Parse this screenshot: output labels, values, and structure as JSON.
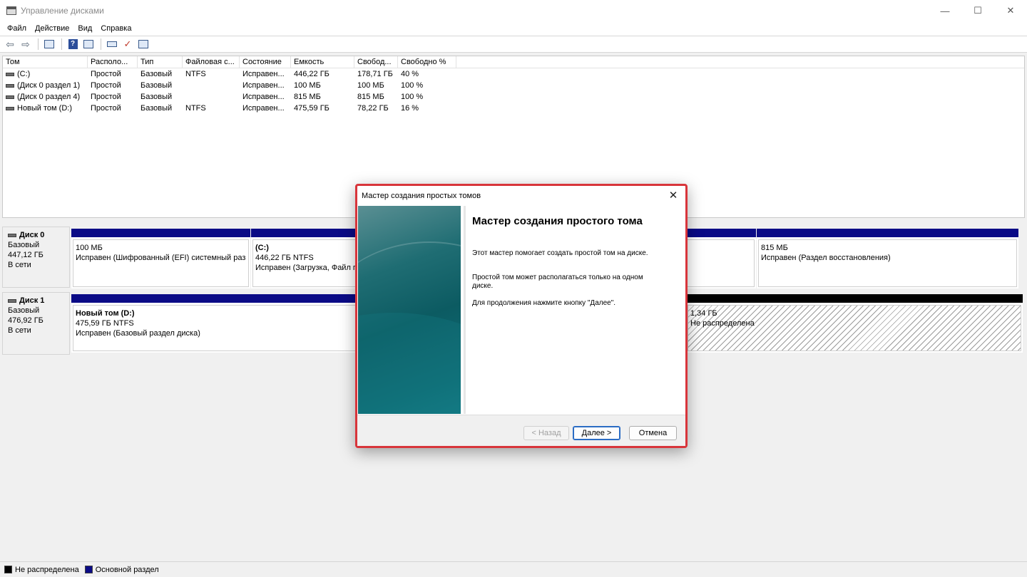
{
  "window": {
    "title": "Управление дисками",
    "controls": {
      "minimize": "—",
      "maximize": "☐",
      "close": "✕"
    }
  },
  "menu": [
    "Файл",
    "Действие",
    "Вид",
    "Справка"
  ],
  "toolbar": {
    "icons": [
      "back-icon",
      "forward-icon",
      "console-tree-icon",
      "help-icon",
      "properties-icon",
      "rescan-icon",
      "check-icon",
      "settings-icon"
    ],
    "glyphs": {
      "back": "⇦",
      "forward": "⇨",
      "help": "?",
      "check": "✓"
    }
  },
  "volumes": {
    "columns": [
      "Том",
      "Располо...",
      "Тип",
      "Файловая с...",
      "Состояние",
      "Емкость",
      "Свобод...",
      "Свободно %"
    ],
    "rows": [
      [
        "(C:)",
        "Простой",
        "Базовый",
        "NTFS",
        "Исправен...",
        "446,22 ГБ",
        "178,71 ГБ",
        "40 %"
      ],
      [
        "(Диск 0 раздел 1)",
        "Простой",
        "Базовый",
        "",
        "Исправен...",
        "100 МБ",
        "100 МБ",
        "100 %"
      ],
      [
        "(Диск 0 раздел 4)",
        "Простой",
        "Базовый",
        "",
        "Исправен...",
        "815 МБ",
        "815 МБ",
        "100 %"
      ],
      [
        "Новый том (D:)",
        "Простой",
        "Базовый",
        "NTFS",
        "Исправен...",
        "475,59 ГБ",
        "78,22 ГБ",
        "16 %"
      ]
    ]
  },
  "disks": [
    {
      "name": "Диск 0",
      "type": "Базовый",
      "size": "447,12 ГБ",
      "status": "В сети",
      "partitions": [
        {
          "title": "",
          "size": "100 МБ",
          "desc": "Исправен (Шифрованный (EFI) системный раз"
        },
        {
          "title": "(C:)",
          "size": "446,22 ГБ NTFS",
          "desc": "Исправен (Загрузка, Файл п"
        },
        {
          "title": "",
          "size": "815 МБ",
          "desc": "Исправен (Раздел восстановления)"
        }
      ]
    },
    {
      "name": "Диск 1",
      "type": "Базовый",
      "size": "476,92 ГБ",
      "status": "В сети",
      "partitions": [
        {
          "title": "Новый том  (D:)",
          "size": "475,59 ГБ NTFS",
          "desc": "Исправен (Базовый раздел диска)"
        },
        {
          "title": "",
          "size": "1,34 ГБ",
          "desc": "Не распределена"
        }
      ]
    }
  ],
  "legend": [
    {
      "label": "Не распределена",
      "color": "#000000"
    },
    {
      "label": "Основной раздел",
      "color": "#0b0b86"
    }
  ],
  "dialog": {
    "title": "Мастер создания простых томов",
    "close": "✕",
    "heading": "Мастер создания простого тома",
    "p1": "Этот мастер помогает создать простой том на диске.",
    "p2": "Простой том может располагаться только на одном диске.",
    "p3": "Для продолжения нажмите кнопку \"Далее\".",
    "buttons": {
      "back": "< Назад",
      "next": "Далее >",
      "cancel": "Отмена"
    },
    "highlight_color": "#d8353b"
  }
}
